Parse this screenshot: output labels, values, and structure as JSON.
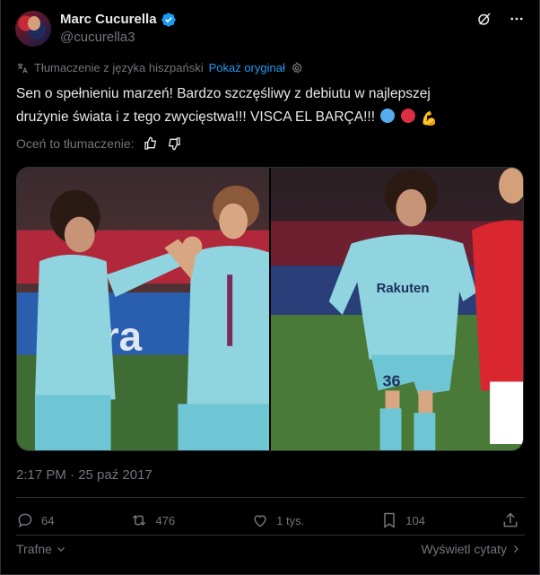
{
  "author": {
    "display_name": "Marc Cucurella",
    "handle": "@cucurella3"
  },
  "icons": {
    "verified": "verified-badge-icon",
    "grok": "grok-icon",
    "more": "more-dots-icon",
    "translate": "translate-icon",
    "settings": "gear-icon",
    "thumbs_up": "thumbs-up-icon",
    "thumbs_down": "thumbs-down-icon",
    "reply": "reply-icon",
    "retweet": "retweet-icon",
    "like": "heart-icon",
    "bookmark": "bookmark-icon",
    "share": "share-icon",
    "chevron": "chevron-icon"
  },
  "colors": {
    "accent": "#1d9bf0",
    "muted": "#71767b",
    "text": "#e7e9ea",
    "background": "#000000"
  },
  "translation": {
    "label": "Tłumaczenie z języka hiszpański",
    "show_original": "Pokaż oryginał"
  },
  "tweet": {
    "line1": "Sen o spełnieniu marzeń! Bardzo szczęśliwy z debiutu w najlepszej",
    "line2": "drużynie świata i z tego zwycięstwa!!! VISCA EL BARÇA!!!",
    "emojis": [
      "blue-circle",
      "red-circle",
      "flexed-biceps"
    ]
  },
  "rate": {
    "label": "Oceń to tłumaczenie:"
  },
  "timestamp": "2:17 PM · 25 paź 2017",
  "stats": {
    "replies": "64",
    "retweets": "476",
    "likes": "1 tys.",
    "bookmarks": "104"
  },
  "footer": {
    "sort": "Trafne",
    "quotes": "Wyświetl cytaty"
  }
}
